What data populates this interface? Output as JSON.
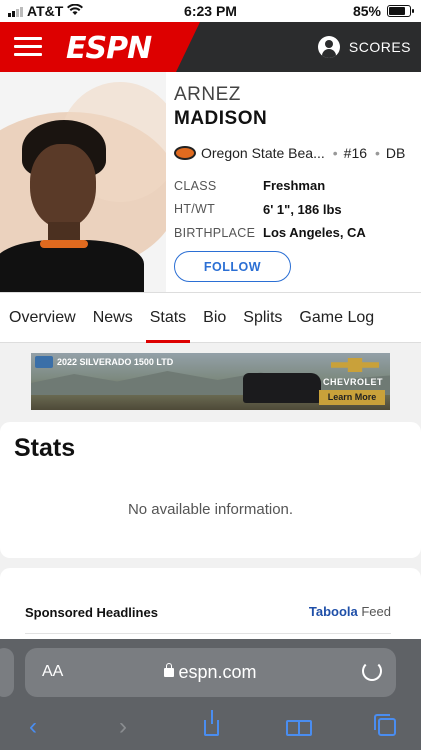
{
  "status_bar": {
    "carrier": "AT&T",
    "time": "6:23 PM",
    "battery": "85%",
    "battery_level": 0.85
  },
  "header": {
    "logo": "ESPN",
    "scores_label": "SCORES",
    "brand_color": "#dd0000",
    "bar_color": "#2b2c2d"
  },
  "player": {
    "first_name": "ARNEZ",
    "last_name": "MADISON",
    "team": "Oregon State Bea...",
    "number": "#16",
    "position": "DB",
    "info": [
      {
        "label": "CLASS",
        "value": "Freshman"
      },
      {
        "label": "HT/WT",
        "value": "6' 1\", 186 lbs"
      },
      {
        "label": "BIRTHPLACE",
        "value": "Los Angeles, CA"
      }
    ],
    "follow_label": "FOLLOW"
  },
  "tabs": [
    "Overview",
    "News",
    "Stats",
    "Bio",
    "Splits",
    "Game Log"
  ],
  "active_tab": "Stats",
  "ad": {
    "title": "2022 SILVERADO 1500 LTD",
    "brand": "CHEVROLET",
    "cta": "Learn More"
  },
  "stats": {
    "heading": "Stats",
    "empty_message": "No available information."
  },
  "sponsored": {
    "label": "Sponsored Headlines",
    "provider": "Taboola",
    "provider_suffix": "Feed"
  },
  "browser": {
    "aa_label": "AA",
    "domain": "espn.com"
  },
  "icons": {
    "menu": "hamburger-icon",
    "user": "user-icon",
    "back": "chevron-left-icon",
    "forward": "chevron-right-icon",
    "share": "share-icon",
    "bookmarks": "book-icon",
    "tabs": "tabs-icon",
    "reload": "reload-icon",
    "lock": "lock-icon"
  }
}
